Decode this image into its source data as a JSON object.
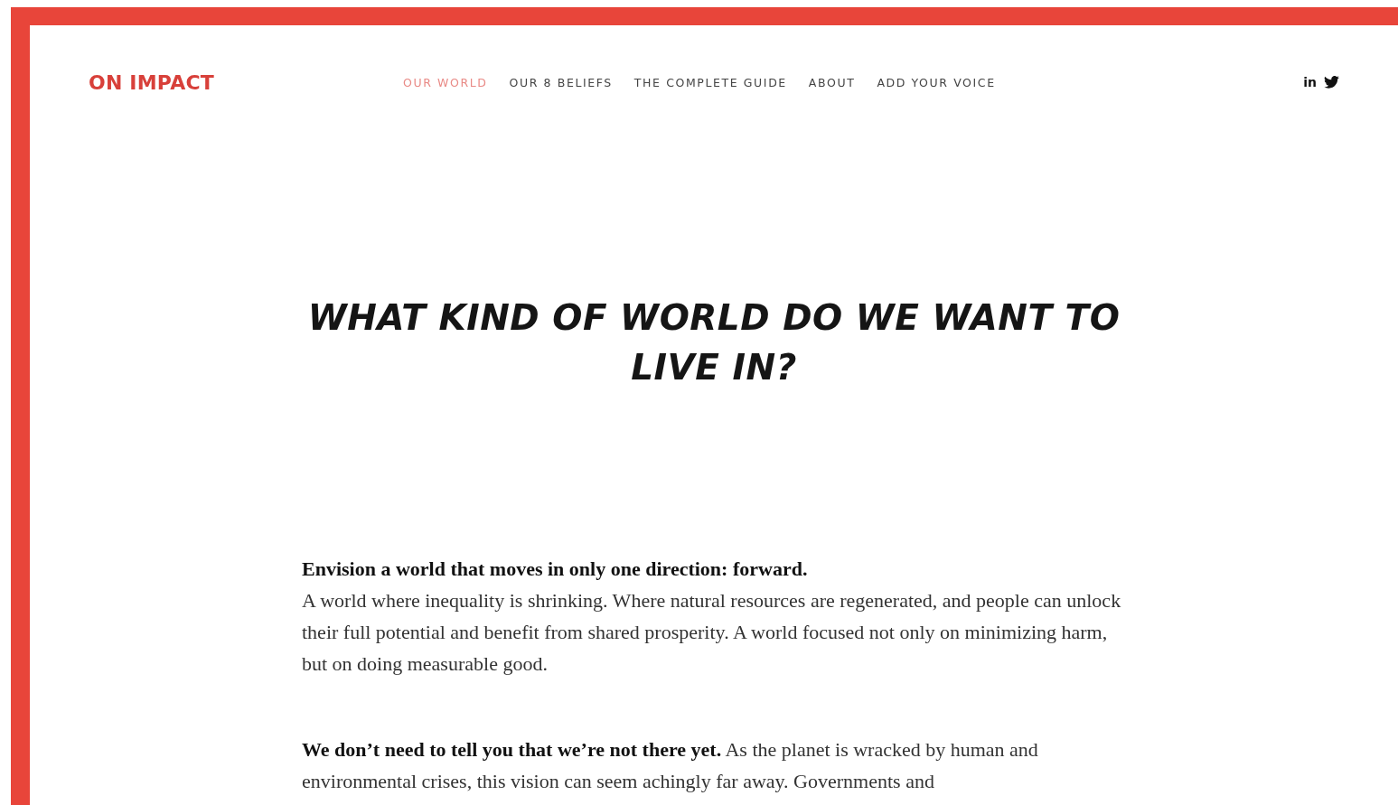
{
  "brand": "ON IMPACT",
  "nav": [
    {
      "label": "OUR WORLD",
      "selected": true
    },
    {
      "label": "OUR 8 BELIEFS",
      "selected": false
    },
    {
      "label": "THE COMPLETE GUIDE",
      "selected": false
    },
    {
      "label": "ABOUT",
      "selected": false
    },
    {
      "label": "ADD YOUR VOICE",
      "selected": false
    }
  ],
  "social": [
    "in"
  ],
  "heading": "WHAT KIND OF WORLD DO WE WANT TO LIVE IN?",
  "sections": [
    {
      "lead": "Envision a world that moves in only one direction: forward.",
      "body": "A world where inequality is shrinking. Where natural resources are regenerated, and people can unlock their full potential and benefit from shared prosperity. A world focused not only on minimizing harm, but on doing measurable good."
    },
    {
      "body": "**We don’t need to tell you that we’re not there yet.** As the planet is wracked by human and environmental crises, this vision can seem achingly far away. Governments and"
    }
  ]
}
